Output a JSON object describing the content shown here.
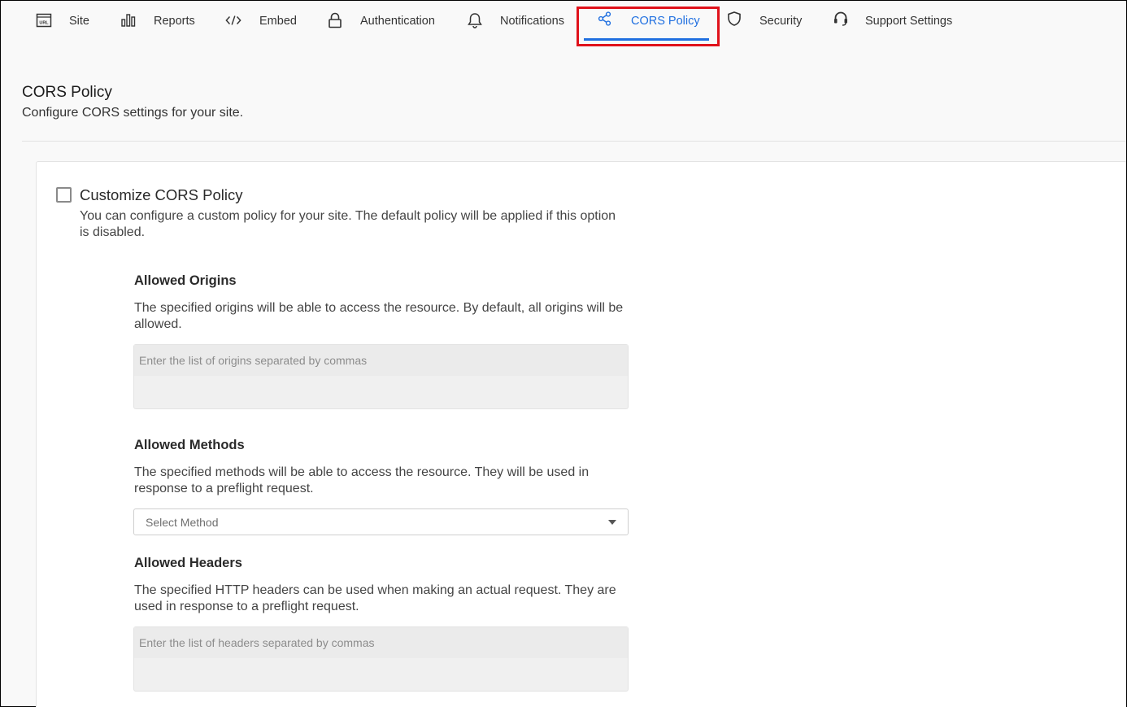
{
  "nav": {
    "tabs": [
      {
        "label": "Site",
        "icon": "url-icon"
      },
      {
        "label": "Reports",
        "icon": "bar-chart-icon"
      },
      {
        "label": "Embed",
        "icon": "code-icon"
      },
      {
        "label": "Authentication",
        "icon": "lock-icon"
      },
      {
        "label": "Notifications",
        "icon": "bell-icon"
      },
      {
        "label": "CORS Policy",
        "icon": "share-nodes-icon",
        "active": true
      },
      {
        "label": "Security",
        "icon": "shield-icon"
      },
      {
        "label": "Support Settings",
        "icon": "headset-icon"
      }
    ],
    "accent_color": "#1f6fe0",
    "highlight_color": "#e0121b"
  },
  "header": {
    "title": "CORS Policy",
    "subtitle": "Configure CORS settings for your site."
  },
  "customize": {
    "label": "Customize CORS Policy",
    "checked": false,
    "description": "You can configure a custom policy for your site. The default policy will be applied if this option is disabled."
  },
  "origins": {
    "title": "Allowed Origins",
    "description": "The specified origins will be able to access the resource. By default, all origins will be allowed.",
    "placeholder": "Enter the list of origins separated by commas",
    "value": ""
  },
  "methods": {
    "title": "Allowed Methods",
    "description": "The specified methods will be able to access the resource. They will be used in response to a preflight request.",
    "placeholder": "Select Method"
  },
  "headers": {
    "title": "Allowed Headers",
    "description": "The specified HTTP headers can be used when making an actual request. They are used in response to a preflight request.",
    "placeholder": "Enter the list of headers separated by commas",
    "value": ""
  }
}
